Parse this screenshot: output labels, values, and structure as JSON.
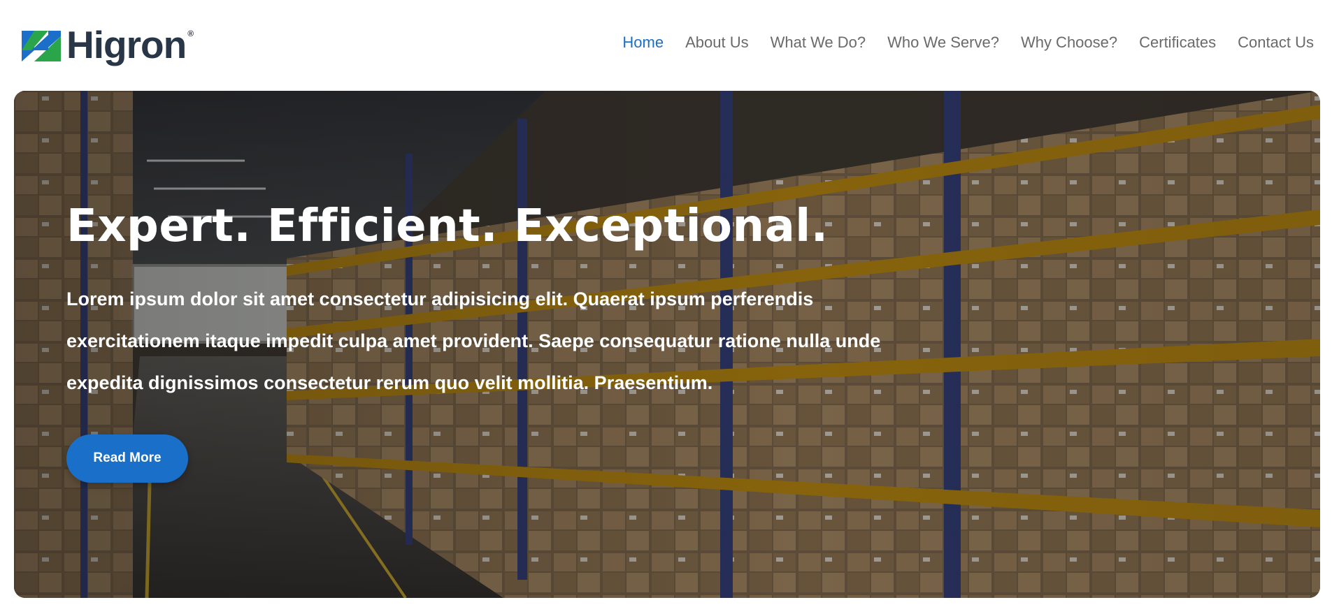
{
  "brand": {
    "name": "Higron",
    "registered_mark": "®",
    "logo_icon": "hg-logo-mark-icon",
    "colors": {
      "green": "#2aa54a",
      "blue": "#1c6fc9",
      "dark": "#283648"
    }
  },
  "nav": {
    "items": [
      {
        "label": "Home",
        "active": true
      },
      {
        "label": "About Us",
        "active": false
      },
      {
        "label": "What We Do?",
        "active": false
      },
      {
        "label": "Who We Serve?",
        "active": false
      },
      {
        "label": "Why Choose?",
        "active": false
      },
      {
        "label": "Certificates",
        "active": false
      },
      {
        "label": "Contact Us",
        "active": false
      }
    ],
    "active_color": "#1c6fc9",
    "text_color": "#6a6a6a"
  },
  "hero": {
    "title": "Expert. Efficient. Exceptional.",
    "text": "Lorem ipsum dolor sit amet consectetur adipisicing elit. Quaerat ipsum perferendis exercitationem itaque impedit culpa amet provident. Saepe consequatur ratione nulla unde expedita dignissimos consectetur rerum quo velit mollitia. Praesentium.",
    "button_label": "Read More",
    "button_color": "#1a6fc8",
    "background_image": "warehouse-shelves-photo"
  }
}
